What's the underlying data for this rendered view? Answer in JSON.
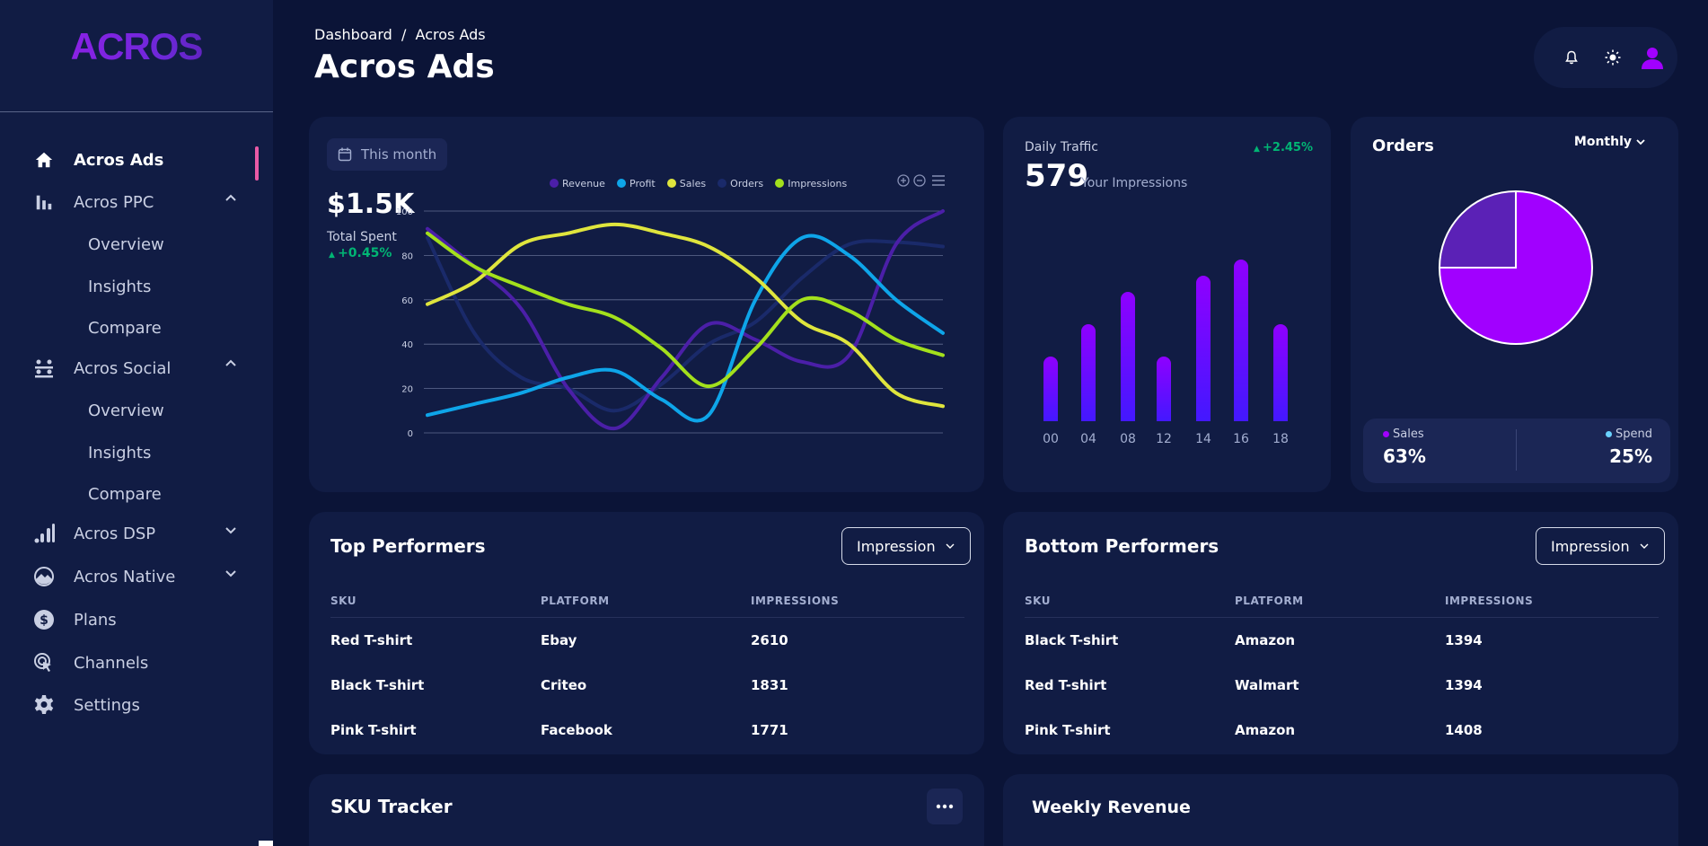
{
  "sidebar": {
    "logo": "ACROS",
    "items": [
      {
        "label": "Acros Ads",
        "icon": "home-icon"
      },
      {
        "label": "Acros PPC",
        "icon": "bar-chart-icon"
      },
      {
        "label": "Overview"
      },
      {
        "label": "Insights"
      },
      {
        "label": "Compare"
      },
      {
        "label": "Acros Social",
        "icon": "people-icon"
      },
      {
        "label": "Overview"
      },
      {
        "label": "Insights"
      },
      {
        "label": "Compare"
      },
      {
        "label": "Acros DSP",
        "icon": "signal-icon"
      },
      {
        "label": "Acros Native",
        "icon": "mountain-icon"
      },
      {
        "label": "Plans",
        "icon": "dollar-icon"
      },
      {
        "label": "Channels",
        "icon": "cursor-click-icon"
      },
      {
        "label": "Settings",
        "icon": "gear-icon"
      }
    ]
  },
  "header": {
    "breadcrumb": "Dashboard  /  Acros Ads",
    "title": "Acros Ads"
  },
  "spend_card": {
    "period": "This month",
    "value": "$1.5K",
    "label": "Total Spent",
    "change": "+0.45%"
  },
  "traffic_card": {
    "title": "Daily Traffic",
    "change": "+2.45%",
    "value": "579",
    "unit": "Your Impressions"
  },
  "orders_card": {
    "title": "Orders",
    "period": "Monthly",
    "sales_label": "Sales",
    "sales_value": "63%",
    "spend_label": "Spend",
    "spend_value": "25%"
  },
  "top_performers": {
    "title": "Top Performers",
    "filter": "Impression",
    "columns": [
      "SKU",
      "PLATFORM",
      "IMPRESSIONS"
    ],
    "rows": [
      [
        "Red T-shirt",
        "Ebay",
        "2610"
      ],
      [
        "Black T-shirt",
        "Criteo",
        "1831"
      ],
      [
        "Pink T-shirt",
        "Facebook",
        "1771"
      ]
    ]
  },
  "bottom_performers": {
    "title": "Bottom Performers",
    "filter": "Impression",
    "columns": [
      "SKU",
      "PLATFORM",
      "IMPRESSIONS"
    ],
    "rows": [
      [
        "Black T-shirt",
        "Amazon",
        "1394"
      ],
      [
        "Red T-shirt",
        "Walmart",
        "1394"
      ],
      [
        "Pink T-shirt",
        "Amazon",
        "1408"
      ]
    ]
  },
  "sku_tracker": {
    "title": "SKU Tracker"
  },
  "weekly_revenue": {
    "title": "Weekly Revenue"
  },
  "colors": {
    "revenue": "#4b1fa8",
    "profit": "#0ea5e9",
    "sales": "#dfe53d",
    "orders": "#1a2a6a",
    "impressions": "#a3e01c",
    "accent_purple": "#a100ff",
    "positive": "#01b574"
  },
  "chart_data": [
    {
      "type": "line",
      "x": [
        0,
        1,
        2,
        3,
        4,
        5,
        6,
        7,
        8,
        9,
        10,
        11
      ],
      "ylim": [
        0,
        100
      ],
      "yticks": [
        0,
        20,
        40,
        60,
        80,
        100
      ],
      "grid": true,
      "legend": "top",
      "series": [
        {
          "name": "Revenue",
          "values": [
            92,
            75,
            56,
            20,
            2,
            25,
            49,
            42,
            32,
            35,
            85,
            100
          ]
        },
        {
          "name": "Profit",
          "values": [
            8,
            13,
            18,
            25,
            28,
            15,
            8,
            60,
            88,
            80,
            60,
            45
          ]
        },
        {
          "name": "Sales",
          "values": [
            58,
            68,
            85,
            90,
            94,
            90,
            84,
            70,
            50,
            40,
            18,
            12
          ]
        },
        {
          "name": "Orders",
          "values": [
            88,
            45,
            25,
            20,
            10,
            22,
            40,
            50,
            70,
            85,
            86,
            84
          ]
        },
        {
          "name": "Impressions",
          "values": [
            90,
            75,
            66,
            58,
            52,
            38,
            21,
            38,
            60,
            55,
            42,
            35
          ]
        }
      ]
    },
    {
      "type": "bar",
      "categories": [
        "00",
        "04",
        "08",
        "12",
        "14",
        "16",
        "18"
      ],
      "values": [
        40,
        60,
        80,
        40,
        90,
        100,
        60
      ]
    },
    {
      "type": "pie",
      "labels": [
        "Sales",
        "Spend"
      ],
      "values": [
        75,
        25
      ]
    }
  ]
}
